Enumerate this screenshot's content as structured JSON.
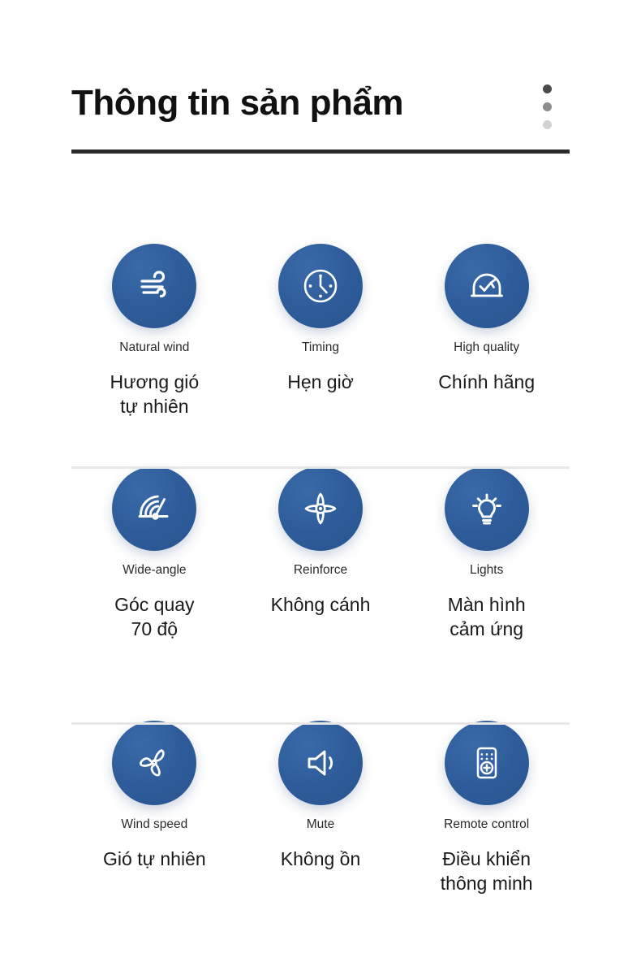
{
  "header": {
    "title": "Thông tin sản phẩm",
    "menu_icon": "kebab-menu-icon",
    "menu_dots": [
      "dot-dark",
      "dot-medium",
      "dot-light"
    ]
  },
  "colors": {
    "badge_blue": "#2f5d9b",
    "badge_blue_light": "#3a6aa8",
    "title_text": "#111111",
    "label_en_text": "#2a2a2a",
    "label_vi_text": "#1a1a1a",
    "title_rule": "#2b2b2b",
    "divider": "#e7e7e7",
    "icon_stroke": "#ffffff",
    "background": "#ffffff"
  },
  "features": [
    {
      "icon": "wind-icon",
      "label_en": "Natural wind",
      "label_vi": "Hương gió\ntự nhiên"
    },
    {
      "icon": "clock-icon",
      "label_en": "Timing",
      "label_vi": "Hẹn giờ"
    },
    {
      "icon": "quality-badge-icon",
      "label_en": "High quality",
      "label_vi": "Chính hãng"
    },
    {
      "icon": "gauge-icon",
      "label_en": "Wide-angle",
      "label_vi": "Góc quay\n70 độ"
    },
    {
      "icon": "fan-blades-icon",
      "label_en": "Reinforce",
      "label_vi": "Không cánh"
    },
    {
      "icon": "lightbulb-icon",
      "label_en": "Lights",
      "label_vi": "Màn hình\ncảm ứng"
    },
    {
      "icon": "propeller-icon",
      "label_en": "Wind speed",
      "label_vi": "Gió tự nhiên"
    },
    {
      "icon": "speaker-mute-icon",
      "label_en": "Mute",
      "label_vi": "Không ồn"
    },
    {
      "icon": "remote-control-icon",
      "label_en": "Remote control",
      "label_vi": "Điều khiển\nthông minh"
    }
  ]
}
